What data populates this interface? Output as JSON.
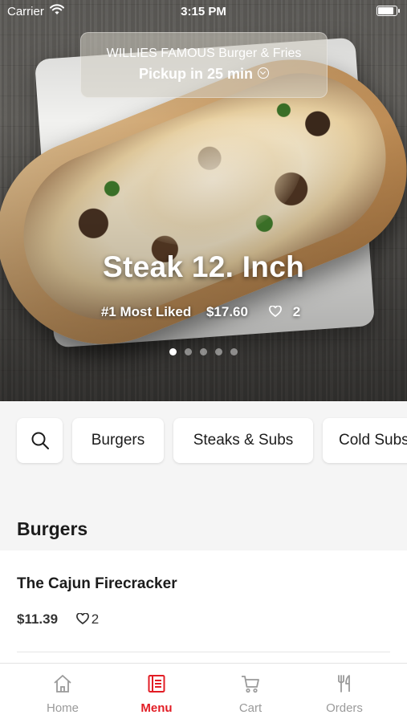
{
  "status_bar": {
    "carrier": "Carrier",
    "time": "3:15 PM",
    "battery_level": 0.95
  },
  "restaurant": {
    "name": "WILLIES FAMOUS Burger & Fries",
    "pickup": "Pickup in 25 min"
  },
  "featured": {
    "name": "Steak 12. Inch",
    "badge": "#1 Most Liked",
    "price": "$17.60",
    "likes": "2",
    "carousel_total": 5,
    "carousel_active": 0
  },
  "categories": {
    "search_icon": "search-icon",
    "items": [
      "Burgers",
      "Steaks & Subs",
      "Cold Subs"
    ]
  },
  "section": {
    "title": "Burgers",
    "items": [
      {
        "name": "The Cajun Firecracker",
        "price": "$11.39",
        "likes": "2"
      }
    ]
  },
  "tabbar": {
    "active": "Menu",
    "tabs": [
      {
        "label": "Home",
        "icon": "home-icon"
      },
      {
        "label": "Menu",
        "icon": "menu-icon"
      },
      {
        "label": "Cart",
        "icon": "cart-icon"
      },
      {
        "label": "Orders",
        "icon": "orders-icon"
      }
    ]
  },
  "colors": {
    "accent": "#e21d25",
    "inactive": "#9a9a9a",
    "background": "#f5f5f5"
  }
}
